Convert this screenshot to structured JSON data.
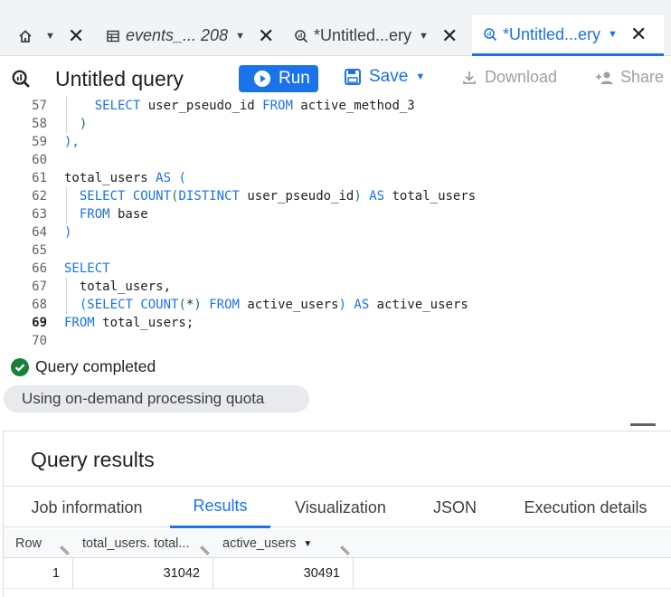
{
  "tabs": [
    {
      "label": "",
      "icon": "home-icon",
      "active": false
    },
    {
      "label": "events_... 208",
      "icon": "table-icon",
      "active": false
    },
    {
      "label": "*Untitled...ery",
      "icon": "query-icon",
      "active": false
    },
    {
      "label": "*Untitled...ery",
      "icon": "query-icon",
      "active": true
    }
  ],
  "toolbar": {
    "title": "Untitled query",
    "run_label": "Run",
    "save_label": "Save",
    "download_label": "Download",
    "share_label": "Share"
  },
  "editor": {
    "lines": [
      {
        "num": "57",
        "current": false,
        "code": [
          [
            "    ",
            ""
          ],
          [
            "SELECT",
            "kw"
          ],
          [
            " user_pseudo_id ",
            ""
          ],
          [
            "FROM",
            "kw"
          ],
          [
            " active_method_3",
            ""
          ]
        ]
      },
      {
        "num": "58",
        "current": false,
        "code": [
          [
            "  ",
            ""
          ],
          [
            ")",
            "pg"
          ]
        ]
      },
      {
        "num": "59",
        "current": false,
        "code": [
          [
            "),",
            "kw"
          ]
        ]
      },
      {
        "num": "60",
        "current": false,
        "code": []
      },
      {
        "num": "61",
        "current": false,
        "code": [
          [
            "total_users ",
            ""
          ],
          [
            "AS",
            "kw"
          ],
          [
            " (",
            "kw"
          ]
        ]
      },
      {
        "num": "62",
        "current": false,
        "code": [
          [
            "  ",
            ""
          ],
          [
            "SELECT",
            "kw"
          ],
          [
            " ",
            ""
          ],
          [
            "COUNT",
            "kw"
          ],
          [
            "(",
            "pg"
          ],
          [
            "DISTINCT",
            "kw"
          ],
          [
            " user_pseudo_id",
            ""
          ],
          [
            ")",
            "pg"
          ],
          [
            " ",
            ""
          ],
          [
            "AS",
            "kw"
          ],
          [
            " total_users",
            ""
          ]
        ]
      },
      {
        "num": "63",
        "current": false,
        "code": [
          [
            "  ",
            ""
          ],
          [
            "FROM",
            "kw"
          ],
          [
            " base",
            ""
          ]
        ]
      },
      {
        "num": "64",
        "current": false,
        "code": [
          [
            ")",
            "kw"
          ]
        ]
      },
      {
        "num": "65",
        "current": false,
        "code": []
      },
      {
        "num": "66",
        "current": false,
        "code": [
          [
            "SELECT",
            "kw"
          ]
        ]
      },
      {
        "num": "67",
        "current": false,
        "code": [
          [
            "  total_users,",
            ""
          ]
        ]
      },
      {
        "num": "68",
        "current": false,
        "code": [
          [
            "  ",
            ""
          ],
          [
            "(",
            "kw"
          ],
          [
            "SELECT",
            "kw"
          ],
          [
            " ",
            ""
          ],
          [
            "COUNT",
            "kw"
          ],
          [
            "(",
            "pg"
          ],
          [
            "*",
            ""
          ],
          [
            ")",
            "pg"
          ],
          [
            " ",
            ""
          ],
          [
            "FROM",
            "kw"
          ],
          [
            " active_users",
            ""
          ],
          [
            ")",
            "kw"
          ],
          [
            " ",
            ""
          ],
          [
            "AS",
            "kw"
          ],
          [
            " active_users",
            ""
          ]
        ]
      },
      {
        "num": "69",
        "current": true,
        "code": [
          [
            "FROM",
            "kw"
          ],
          [
            " total_users;",
            ""
          ]
        ]
      },
      {
        "num": "70",
        "current": false,
        "code": []
      }
    ]
  },
  "status": {
    "message": "Query completed",
    "quota_label": "Using on-demand processing quota"
  },
  "results": {
    "title": "Query results",
    "tabs": [
      {
        "label": "Job information",
        "active": false
      },
      {
        "label": "Results",
        "active": true
      },
      {
        "label": "Visualization",
        "active": false
      },
      {
        "label": "JSON",
        "active": false
      },
      {
        "label": "Execution details",
        "active": false
      }
    ],
    "columns": [
      "Row",
      "total_users. total...",
      "active_users"
    ],
    "rows": [
      [
        "1",
        "31042",
        "30491"
      ]
    ]
  },
  "colors": {
    "accent": "#1a73e8",
    "success": "#188038",
    "paren_green": "#188038"
  }
}
